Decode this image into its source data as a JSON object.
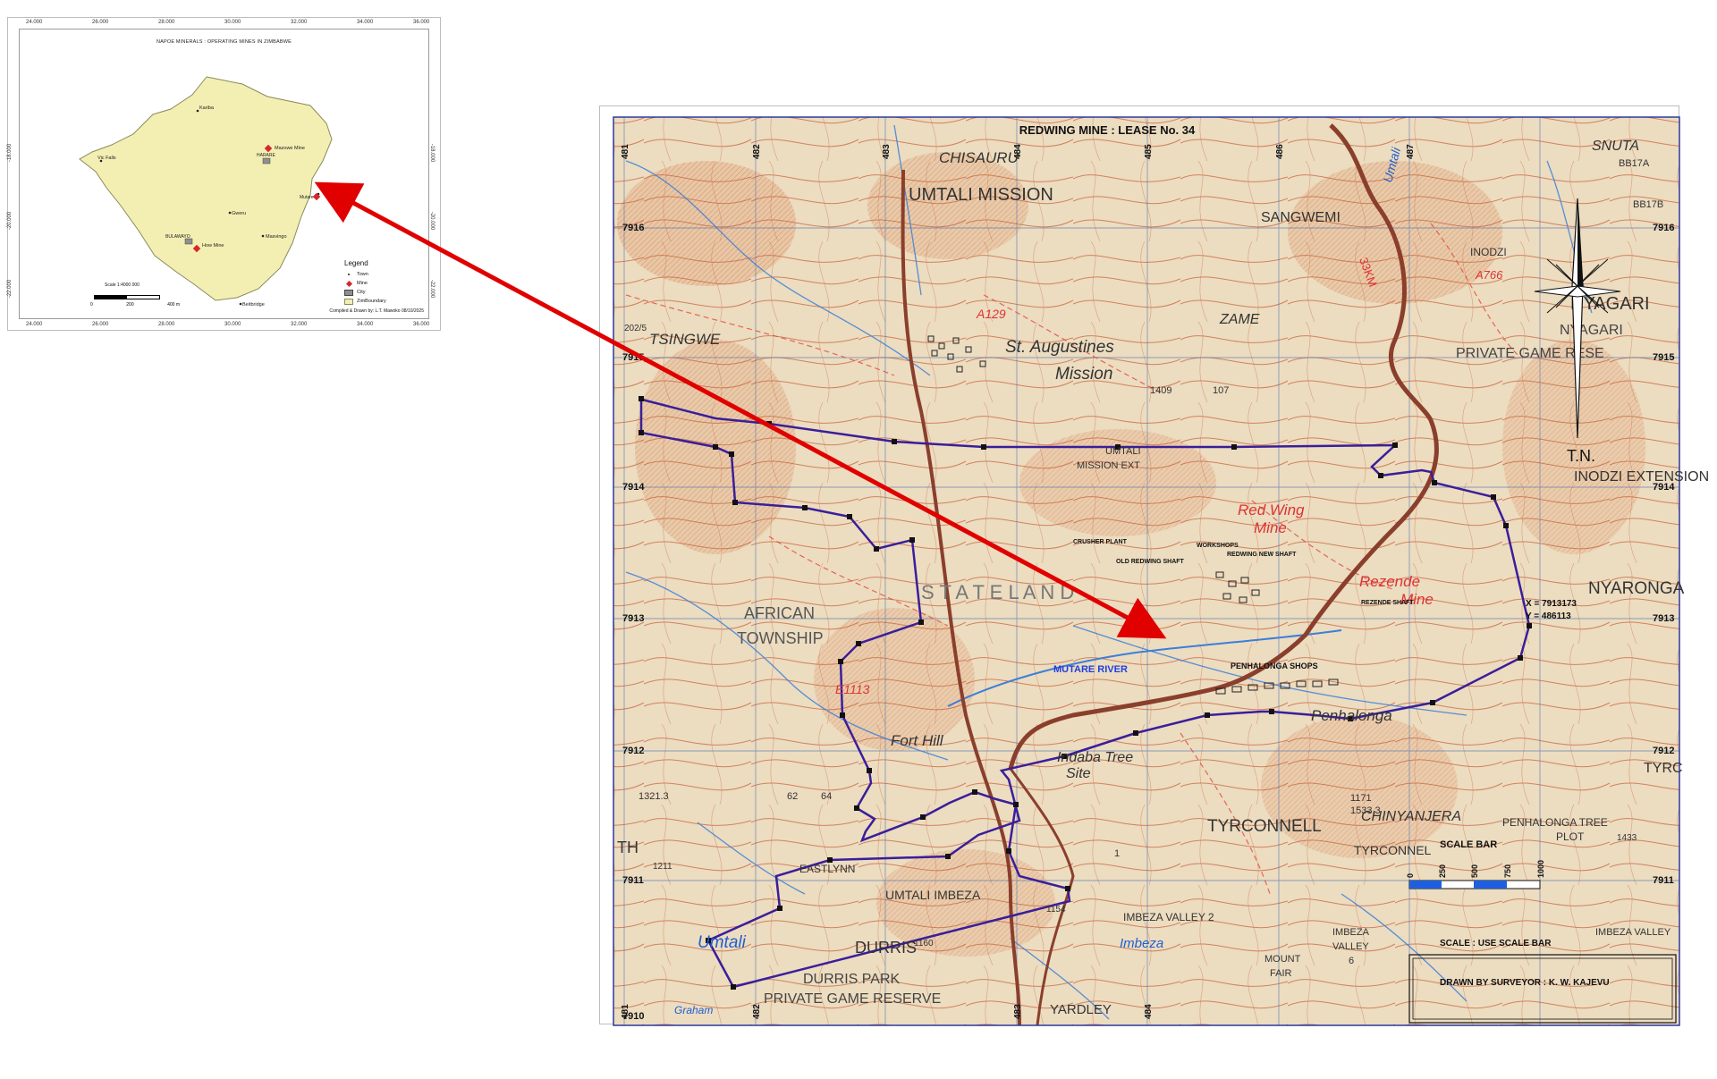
{
  "inset": {
    "title": "NAPOE MINERALS : OPERATING MINES IN ZIMBABWE",
    "ticks_top": [
      "24.000",
      "26.000",
      "28.000",
      "30.000",
      "32.000",
      "34.000",
      "36.000"
    ],
    "ticks_bottom": [
      "24.000",
      "26.000",
      "28.000",
      "30.000",
      "32.000",
      "34.000",
      "36.000"
    ],
    "ticks_left": [
      "-18.000",
      "-20.000",
      "-22.000"
    ],
    "ticks_right": [
      "-18.000",
      "-20.000",
      "-22.000"
    ],
    "places": {
      "kariba": "Kariba",
      "vic_falls": "Vic Falls",
      "harare": "HARARE",
      "mazowe": "Mazowe Mine",
      "mutare": "Mutare",
      "redwing": "Redwing Mine",
      "gweru": "Gweru",
      "bulawayo": "BULAWAYO",
      "how_mine": "How Mine",
      "masvingo": "Masvingo",
      "beitbridge": "Beitbridge"
    },
    "legend": {
      "title": "Legend",
      "items": [
        "Town",
        "Mine",
        "City",
        "ZimBoundary"
      ]
    },
    "scale_text": "Scale 1:4000 000",
    "scale_numbers": [
      "0",
      "200",
      "400 m"
    ],
    "credit": "Compiled & Drawn by: L.T. Mawoko 08/10/2025"
  },
  "map": {
    "title": "REDWING MINE : LEASE No. 34",
    "places": {
      "chisauru": "CHISAURU",
      "umtali_mission": "UMTALI MISSION",
      "sangwemi": "SANGWEMI",
      "snuta": "SNUTA",
      "inodzi": "INODZI",
      "nyagari": "NYAGARI",
      "nyagari_reserve_1": "NYAGARI",
      "nyagari_reserve_2": "PRIVATE GAME RESE",
      "zame": "ZAME",
      "tsingwe": "TSINGWE",
      "st_augustines": "St. Augustines",
      "mission": "Mission",
      "umtali_mission_ext_1": "UMTALI",
      "umtali_mission_ext_2": "MISSION EXT",
      "inodzi_extension": "INODZI EXTENSION",
      "red_wing_mine_1": "Red Wing",
      "red_wing_mine_2": "Mine",
      "rezende_mine_1": "Rezende",
      "rezende_mine_2": "Mine",
      "nyaronga": "NYARONGA",
      "state_land": "S T A T E   L A N D",
      "african_township_1": "AFRICAN",
      "african_township_2": "TOWNSHIP",
      "mutare_river": "MUTARE RIVER",
      "penhalonga_shops": "PENHALONGA SHOPS",
      "penhalonga": "Penhalonga",
      "fort_hill": "Fort Hill",
      "indaba_tree_1": "Indaba Tree",
      "indaba_tree_2": "Site",
      "tyrconnell": "TYRCONNELL",
      "chinyanjera": "CHINYANJERA",
      "penhalonga_tree_plot_1": "PENHALONGA TREE",
      "penhalonga_tree_plot_2": "PLOT",
      "tyrconnel": "TYRCONNEL",
      "tyrc": "TYRC",
      "eastlynn": "EASTLYNN",
      "umtali_imbeza": "UMTALI IMBEZA",
      "umtali_river": "Umtali",
      "durris": "DURRIS",
      "durris_park_1": "DURRIS PARK",
      "durris_park_2": "PRIVATE GAME RESERVE",
      "yardley": "YARDLEY",
      "imbeza": "Imbeza",
      "imbeza_valley_2": "IMBEZA VALLEY 2",
      "imbeza_valley_6_1": "IMBEZA",
      "imbeza_valley_6_2": "VALLEY",
      "imbeza_valley_6_3": "6",
      "mount_fair_1": "MOUNT",
      "mount_fair_2": "FAIR",
      "imbeza_valley_right": "IMBEZA VALLEY",
      "graham": "Graham",
      "umtali_road": "Umtali",
      "road_33km": "33KM",
      "th": "TH",
      "a129": "A129",
      "a766": "A766",
      "bb17a": "BB17A",
      "bb17b": "BB17B",
      "e1113": "E1113",
      "h1409": "1409",
      "h107": "107",
      "h1321": "1321.3",
      "h1211": "1211",
      "h1533": "1533.3",
      "h1154": "1154",
      "h1160": "1160",
      "h1171": "1171",
      "h62": "62",
      "h64": "64",
      "h202": "202/5",
      "h1433": "1433",
      "h1": "1"
    },
    "northings": [
      "7916",
      "7915",
      "7914",
      "7913",
      "7912",
      "7911",
      "7910"
    ],
    "eastings_top": [
      "481",
      "482",
      "483",
      "484",
      "485",
      "486",
      "487"
    ],
    "eastings_bottom": [
      "481",
      "482",
      "483",
      "484"
    ],
    "coords_label_1": "X = 7913173",
    "coords_label_2": "Y = 486113",
    "buildings": {
      "b1": "CRUSHER PLANT",
      "b2": "OLD REDWING SHAFT",
      "b3": "WORKSHOPS",
      "b4": "REDWING NEW SHAFT",
      "b5": "REZENDE SHAFT"
    },
    "north_label": "T.N.",
    "scale_bar_title": "SCALE BAR",
    "scale_bar_numbers": [
      "0",
      "250",
      "500",
      "750",
      "1000"
    ],
    "scale_note": "SCALE  :  USE SCALE BAR",
    "drawn_by": "DRAWN BY  SURVEYOR  :    K. W. KAJEVU"
  },
  "colors": {
    "map_bg": "#ecdcc0",
    "contour": "#c8643c",
    "grid": "#4a6fb0",
    "boundary": "#3a1e9a",
    "road": "#8a3f2c",
    "arrow": "#e00000",
    "zimbabwe_fill": "#f3efb3",
    "mine_marker": "#d8262a"
  }
}
